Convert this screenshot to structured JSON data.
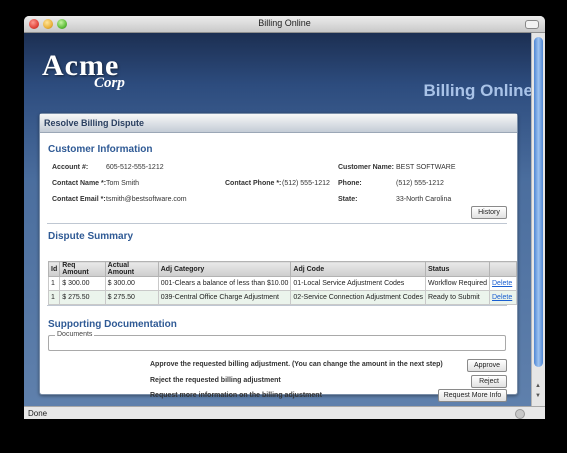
{
  "window": {
    "title": "Billing Online"
  },
  "header": {
    "logo_main": "Acme",
    "logo_sub": "Corp",
    "app_title": "Billing Online"
  },
  "panel_title": "Resolve Billing Dispute",
  "customer": {
    "section_title": "Customer Information",
    "account_label": "Account #:",
    "account_value": "605-512-555-1212",
    "customer_name_label": "Customer Name:",
    "customer_name_value": "BEST SOFTWARE",
    "contact_name_label": "Contact Name *:",
    "contact_name_value": "Tom Smith",
    "contact_phone_label": "Contact Phone *:",
    "contact_phone_value": "(512) 555-1212",
    "phone_label": "Phone:",
    "phone_value": "(512) 555-1212",
    "contact_email_label": "Contact Email *:",
    "contact_email_value": "tsmith@bestsoftware.com",
    "state_label": "State:",
    "state_value": "33-North Carolina",
    "history_button": "History"
  },
  "dispute": {
    "section_title": "Dispute Summary",
    "columns": [
      "Id",
      "Req Amount",
      "Actual Amount",
      "Adj Category",
      "Adj Code",
      "Status",
      ""
    ],
    "rows": [
      {
        "id": "1",
        "req": "$ 300.00",
        "actual": "$ 300.00",
        "category": "001-Clears a balance of less than $10.00",
        "code": "01-Local Service Adjustment Codes",
        "status": "Workflow Required",
        "action": "Delete"
      },
      {
        "id": "1",
        "req": "$ 275.50",
        "actual": "$ 275.50",
        "category": "039-Central Office Charge Adjustment",
        "code": "02-Service Connection Adjustment Codes",
        "status": "Ready to Submit",
        "action": "Delete"
      }
    ]
  },
  "docs": {
    "section_title": "Supporting Documentation",
    "legend": "Documents"
  },
  "actions": [
    {
      "text": "Approve the requested billing adjustment. (You can change the amount in the next step)",
      "button": "Approve"
    },
    {
      "text": "Reject the requested billing adjustment",
      "button": "Reject"
    },
    {
      "text": "Request more information on the billing adjustment",
      "button": "Request More Info"
    }
  ],
  "status_bar": {
    "text": "Done"
  }
}
